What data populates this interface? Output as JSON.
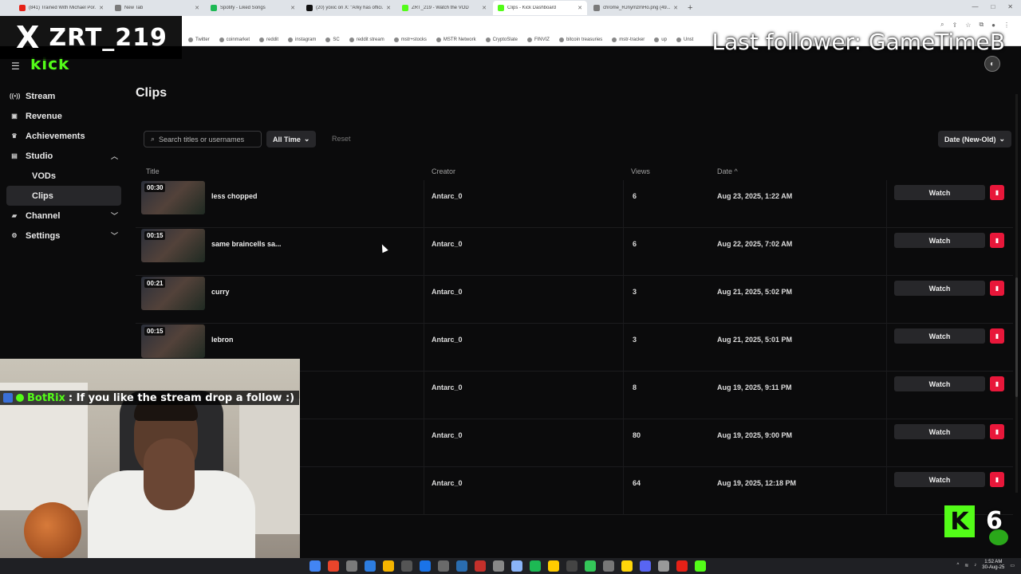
{
  "browser": {
    "tabs": [
      {
        "label": "(841) Trained With Michael Por...",
        "color": "#e62117"
      },
      {
        "label": "New Tab",
        "color": "#7a7a7a"
      },
      {
        "label": "Spotify - Liked Songs",
        "color": "#1db954"
      },
      {
        "label": "(20) yoxic on X: \"Arky has offici...",
        "color": "#111111"
      },
      {
        "label": "ZRT_219 - Watch the VOD",
        "color": "#53fc18"
      },
      {
        "label": "Clips - Kick Dashboard",
        "color": "#53fc18",
        "active": true
      },
      {
        "label": "chrome_RJnymzmHo.png (49...",
        "color": "#7a7a7a"
      }
    ],
    "bookmarks": [
      "Twitter",
      "coinmarket",
      "reddit",
      "instagram",
      "SC",
      "reddit stream",
      "mstr+stocks",
      "MSTR Network",
      "CryptoSlate",
      "FINVIZ",
      "bitcoin treasuries",
      "mstr-tracker",
      "up",
      "Unst"
    ]
  },
  "sidebar": {
    "items": [
      {
        "label": "Stream",
        "icon": "broadcast-icon"
      },
      {
        "label": "Revenue",
        "icon": "wallet-icon"
      },
      {
        "label": "Achievements",
        "icon": "trophy-icon"
      },
      {
        "label": "Studio",
        "icon": "studio-icon",
        "expanded": true
      },
      {
        "label": "VODs",
        "sub": true
      },
      {
        "label": "Clips",
        "sub": true,
        "active": true
      },
      {
        "label": "Channel",
        "icon": "channel-icon",
        "expanded": false
      },
      {
        "label": "Settings",
        "icon": "gear-icon",
        "expanded": false
      }
    ]
  },
  "main": {
    "title": "Clips",
    "search_placeholder": "Search titles or usernames",
    "time_filter": "All Time",
    "reset_label": "Reset",
    "sort_label": "Date (New-Old)",
    "columns": {
      "title": "Title",
      "creator": "Creator",
      "views": "Views",
      "date": "Date"
    },
    "watch_label": "Watch",
    "rows": [
      {
        "duration": "00:30",
        "title": "less chopped",
        "creator": "Antarc_0",
        "views": "6",
        "date": "Aug 23, 2025, 1:22 AM"
      },
      {
        "duration": "00:15",
        "title": "same braincells sa...",
        "creator": "Antarc_0",
        "views": "6",
        "date": "Aug 22, 2025, 7:02 AM"
      },
      {
        "duration": "00:21",
        "title": "curry",
        "creator": "Antarc_0",
        "views": "3",
        "date": "Aug 21, 2025, 5:02 PM"
      },
      {
        "duration": "00:15",
        "title": "lebron",
        "creator": "Antarc_0",
        "views": "3",
        "date": "Aug 21, 2025, 5:01 PM"
      },
      {
        "duration": "",
        "title": "",
        "creator": "Antarc_0",
        "views": "8",
        "date": "Aug 19, 2025, 9:11 PM"
      },
      {
        "duration": "",
        "title": "",
        "creator": "Antarc_0",
        "views": "80",
        "date": "Aug 19, 2025, 9:00 PM"
      },
      {
        "duration": "",
        "title": "",
        "creator": "Antarc_0",
        "views": "64",
        "date": "Aug 19, 2025, 12:18 PM"
      }
    ]
  },
  "overlay": {
    "x_handle": "ZRT_219",
    "last_follower": "Last follower: GameTimeB",
    "chat_user": "BotRix",
    "chat_text": ": If you like the stream drop a follow :)",
    "kick_badge": "K",
    "kick_count": "6"
  },
  "taskbar": {
    "time": "1:52 AM",
    "date": "30-Aug-25"
  }
}
